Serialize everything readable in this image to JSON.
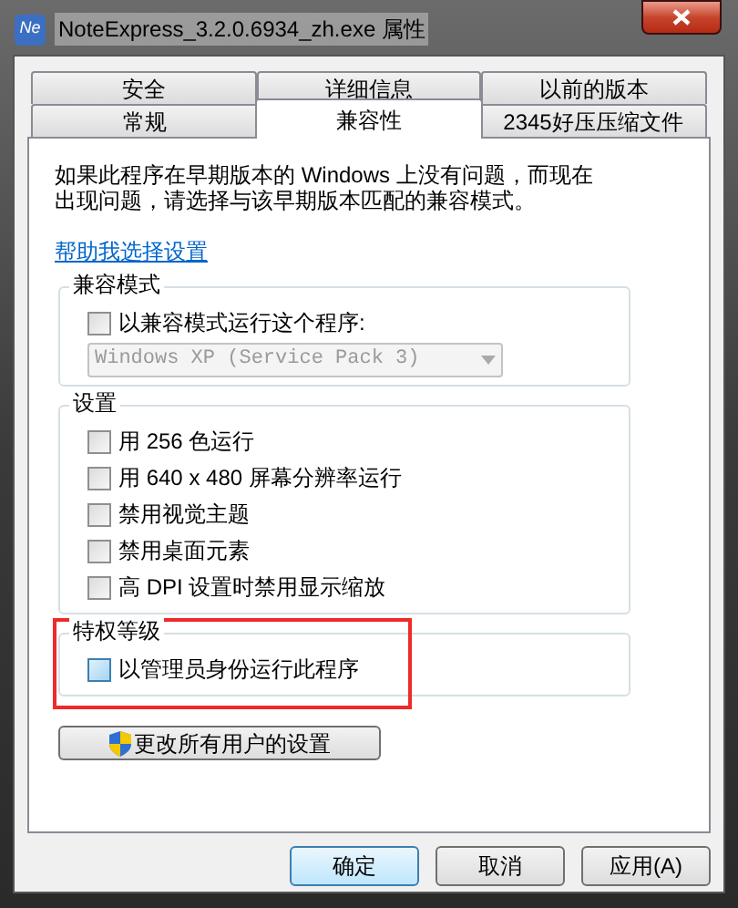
{
  "window": {
    "title": "NoteExpress_3.2.0.6934_zh.exe 属性",
    "icon_label": "Ne"
  },
  "tab_rows": [
    [
      {
        "label": "安全",
        "selected": false
      },
      {
        "label": "详细信息",
        "selected": false
      },
      {
        "label": "以前的版本",
        "selected": false
      }
    ],
    [
      {
        "label": "常规",
        "selected": false
      },
      {
        "label": "兼容性",
        "selected": true
      },
      {
        "label": "2345好压压缩文件",
        "selected": false
      }
    ]
  ],
  "description": "如果此程序在早期版本的 Windows 上没有问题，而现在出现问题，请选择与该早期版本匹配的兼容模式。",
  "help_link": "帮助我选择设置",
  "groups": [
    {
      "title": "兼容模式",
      "highlighted": false,
      "items": [
        {
          "kind": "checkbox",
          "label": "以兼容模式运行这个程序:",
          "checked": false,
          "hovered": false
        },
        {
          "kind": "dropdown",
          "value": "Windows XP (Service Pack 3)",
          "disabled": true
        }
      ]
    },
    {
      "title": "设置",
      "highlighted": false,
      "items": [
        {
          "kind": "checkbox",
          "label": "用 256 色运行",
          "checked": false,
          "hovered": false
        },
        {
          "kind": "checkbox",
          "label": "用 640 x 480 屏幕分辨率运行",
          "checked": false,
          "hovered": false
        },
        {
          "kind": "checkbox",
          "label": "禁用视觉主题",
          "checked": false,
          "hovered": false
        },
        {
          "kind": "checkbox",
          "label": "禁用桌面元素",
          "checked": false,
          "hovered": false
        },
        {
          "kind": "checkbox",
          "label": "高 DPI 设置时禁用显示缩放",
          "checked": false,
          "hovered": false
        }
      ]
    },
    {
      "title": "特权等级",
      "highlighted": true,
      "items": [
        {
          "kind": "checkbox",
          "label": "以管理员身份运行此程序",
          "checked": false,
          "hovered": true
        }
      ]
    }
  ],
  "all_users_button": "更改所有用户的设置",
  "buttons": [
    {
      "label": "确定",
      "default": true
    },
    {
      "label": "取消",
      "default": false
    },
    {
      "label": "应用(A)",
      "default": false
    }
  ]
}
